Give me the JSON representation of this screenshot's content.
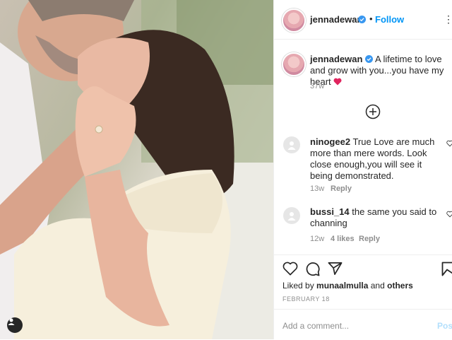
{
  "post": {
    "username": "jennadewan",
    "follow_label": "Follow",
    "dot": "•",
    "more": "⋮",
    "caption_user": "jennadewan",
    "caption_text": "A lifetime to love and grow with you...you have my heart",
    "caption_emoji": "❤️",
    "caption_age": "37w",
    "load_more": "⊕"
  },
  "comments": [
    {
      "user": "ninogee2",
      "text": "True Love are much more than mere words. Look close enough,you will see it being demonstrated.",
      "age": "13w",
      "likes": "",
      "reply": "Reply"
    },
    {
      "user": "bussi_14",
      "text": "the same you said to channing",
      "age": "12w",
      "likes": "4 likes",
      "reply": "Reply"
    }
  ],
  "liked_by": {
    "prefix": "Liked by",
    "user": "munaalmulla",
    "and": "and",
    "others": "others"
  },
  "date": "FEBRUARY 18",
  "add_comment": {
    "placeholder": "Add a comment...",
    "post_label": "Post"
  },
  "colors": {
    "accent": "#0095f6",
    "verified": "#3897f0",
    "heart": "#ed4956"
  }
}
